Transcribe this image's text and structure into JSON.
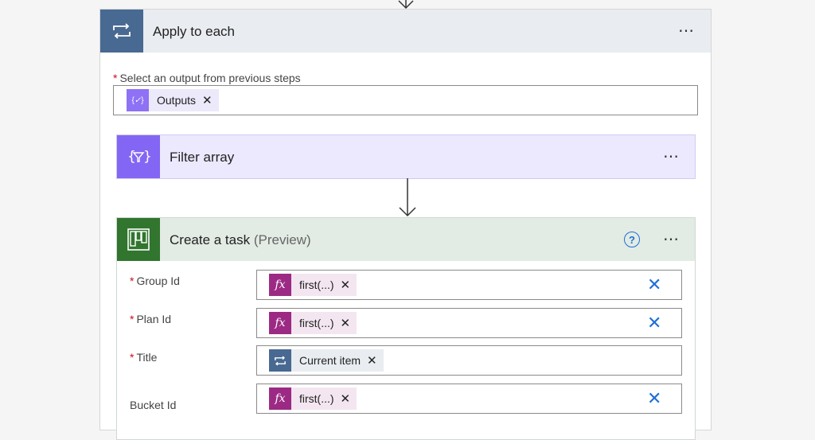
{
  "loop": {
    "title": "Apply to each",
    "more": "⋯",
    "select_label": "Select an output from previous steps",
    "token": {
      "label": "Outputs",
      "icon": "expression-braces-icon",
      "remove": "✕"
    }
  },
  "filter": {
    "title": "Filter array",
    "icon": "filter-braces-icon",
    "more": "⋯"
  },
  "task": {
    "title": "Create a task",
    "preview": "(Preview)",
    "help": "?",
    "more": "⋯",
    "fields": [
      {
        "label": "Group Id",
        "required": true,
        "token": "first(...)",
        "token_kind": "expression",
        "fx": "fx",
        "remove": "✕",
        "clear": "✕"
      },
      {
        "label": "Plan Id",
        "required": true,
        "token": "first(...)",
        "token_kind": "expression",
        "fx": "fx",
        "remove": "✕",
        "clear": "✕"
      },
      {
        "label": "Title",
        "required": true,
        "token": "Current item",
        "token_kind": "loop",
        "remove": "✕"
      },
      {
        "label": "Bucket Id",
        "required": false,
        "token": "first(...)",
        "token_kind": "expression",
        "fx": "fx",
        "remove": "✕",
        "clear": "✕"
      }
    ]
  },
  "required_mark": "*",
  "colors": {
    "loop": "#486991",
    "filter": "#8466f4",
    "planner": "#31752f",
    "expression": "#9c2a84",
    "link": "#1f6fd6"
  }
}
